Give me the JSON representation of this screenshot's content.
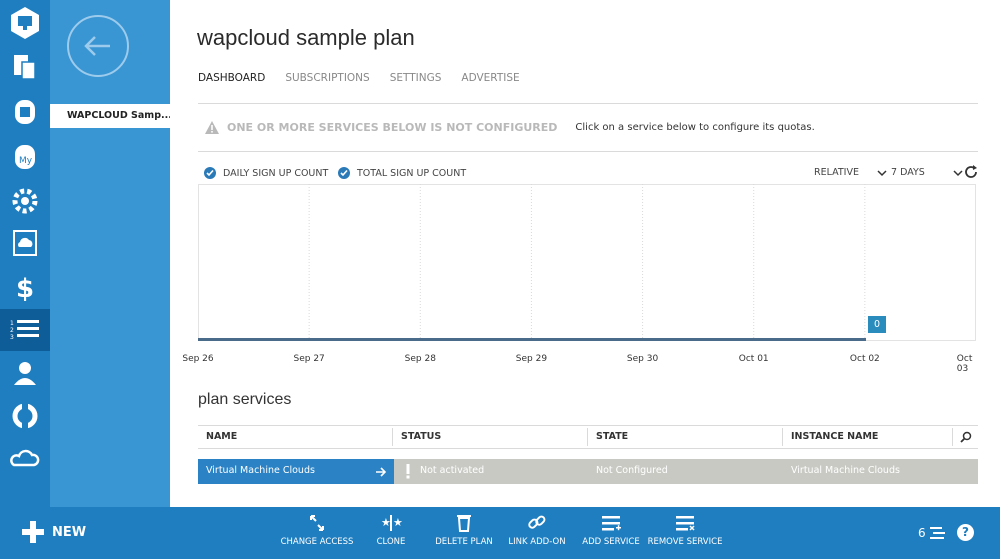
{
  "panel": {
    "selected_item": "WAPCLOUD Samp..."
  },
  "page": {
    "title": "wapcloud sample plan"
  },
  "tabs": [
    {
      "label": "DASHBOARD",
      "active": true
    },
    {
      "label": "SUBSCRIPTIONS",
      "active": false
    },
    {
      "label": "SETTINGS",
      "active": false
    },
    {
      "label": "ADVERTISE",
      "active": false
    }
  ],
  "warning": {
    "title": "ONE OR MORE SERVICES BELOW IS NOT CONFIGURED",
    "text": "Click on a service below to configure its quotas."
  },
  "chart_controls": {
    "legend": [
      "DAILY SIGN UP COUNT",
      "TOTAL SIGN UP COUNT"
    ],
    "mode": "RELATIVE",
    "range": "7 DAYS"
  },
  "chart_data": {
    "type": "line",
    "x": [
      "Sep 26",
      "Sep 27",
      "Sep 28",
      "Sep 29",
      "Sep 30",
      "Oct 01",
      "Oct 02",
      "Oct 03"
    ],
    "series": [
      {
        "name": "DAILY SIGN UP COUNT",
        "values": [
          0,
          0,
          0,
          0,
          0,
          0,
          0
        ]
      },
      {
        "name": "TOTAL SIGN UP COUNT",
        "values": [
          0,
          0,
          0,
          0,
          0,
          0,
          0
        ]
      }
    ],
    "data_label": "0"
  },
  "services": {
    "title": "plan services",
    "columns": [
      "NAME",
      "STATUS",
      "STATE",
      "INSTANCE NAME"
    ],
    "rows": [
      {
        "name": "Virtual Machine Clouds",
        "status": "Not activated",
        "state": "Not Configured",
        "instance": "Virtual Machine Clouds"
      }
    ]
  },
  "command_bar": {
    "new_label": "NEW",
    "commands": [
      "CHANGE ACCESS",
      "CLONE",
      "DELETE PLAN",
      "LINK ADD-ON",
      "ADD SERVICE",
      "REMOVE SERVICE"
    ],
    "notification_count": "6",
    "help": "?"
  },
  "colors": {
    "rail": "#1f7ec0",
    "panel": "#3a95d3",
    "selected": "#2b83c6",
    "row": "#c9c9c4"
  }
}
